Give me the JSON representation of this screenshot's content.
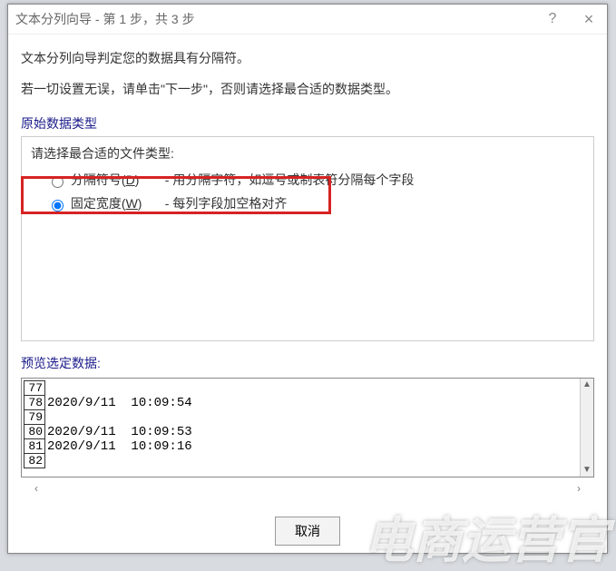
{
  "title": "文本分列向导 - 第 1 步，共 3 步",
  "window_controls": {
    "help": "?",
    "close": "×"
  },
  "intro1": "文本分列向导判定您的数据具有分隔符。",
  "intro2": "若一切设置无误，请单击\"下一步\"，否则请选择最合适的数据类型。",
  "section1_title": "原始数据类型",
  "section1_prompt": "请选择最合适的文件类型:",
  "options": {
    "delimited": {
      "label_pre": "分隔符号(",
      "label_accel": "D",
      "label_post": ")",
      "desc": "- 用分隔字符，如逗号或制表符分隔每个字段",
      "checked": false
    },
    "fixed": {
      "label_pre": "固定宽度(",
      "label_accel": "W",
      "label_post": ")",
      "desc": "- 每列字段加空格对齐",
      "checked": true
    }
  },
  "preview_label": "预览选定数据:",
  "preview_rows": [
    {
      "n": "77",
      "v": ""
    },
    {
      "n": "78",
      "v": "2020/9/11  10:09:54"
    },
    {
      "n": "79",
      "v": ""
    },
    {
      "n": "80",
      "v": "2020/9/11  10:09:53"
    },
    {
      "n": "81",
      "v": "2020/9/11  10:09:16"
    },
    {
      "n": "82",
      "v": ""
    }
  ],
  "scroll": {
    "left": "‹",
    "right": "›"
  },
  "buttons": {
    "cancel": "取消"
  },
  "watermark": "电商运营官"
}
